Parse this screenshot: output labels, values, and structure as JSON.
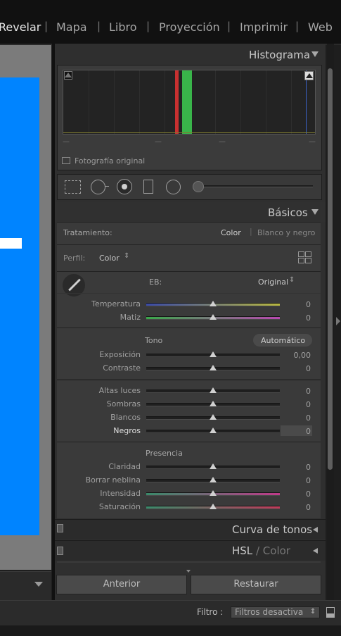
{
  "modules": [
    "Revelar",
    "Mapa",
    "Libro",
    "Proyección",
    "Imprimir",
    "Web"
  ],
  "active_module": "Revelar",
  "histogram": {
    "title": "Histograma",
    "orig_photo_label": "Fotografía original",
    "readouts": [
      "—",
      "—",
      "—",
      "—"
    ]
  },
  "basic": {
    "title": "Básicos",
    "treatment_label": "Tratamiento:",
    "treatment_color": "Color",
    "treatment_bw": "Blanco y negro",
    "profile_label": "Perfil:",
    "profile_value": "Color",
    "wb_label": "EB:",
    "wb_value": "Original",
    "temp_label": "Temperatura",
    "temp_value": "0",
    "tint_label": "Matiz",
    "tint_value": "0",
    "tone_label": "Tono",
    "auto_label": "Automático",
    "exposure_label": "Exposición",
    "exposure_value": "0,00",
    "contrast_label": "Contraste",
    "contrast_value": "0",
    "highlights_label": "Altas luces",
    "highlights_value": "0",
    "shadows_label": "Sombras",
    "shadows_value": "0",
    "whites_label": "Blancos",
    "whites_value": "0",
    "blacks_label": "Negros",
    "blacks_value": "0",
    "presence_label": "Presencia",
    "clarity_label": "Claridad",
    "clarity_value": "0",
    "dehaze_label": "Borrar neblina",
    "dehaze_value": "0",
    "vibrance_label": "Intensidad",
    "vibrance_value": "0",
    "saturation_label": "Saturación",
    "saturation_value": "0"
  },
  "panels": {
    "tone_curve": "Curva de tonos",
    "hsl": "HSL",
    "hsl_sep": "/",
    "color": "Color"
  },
  "buttons": {
    "previous": "Anterior",
    "reset": "Restaurar"
  },
  "filter": {
    "label": "Filtro :",
    "value": "Filtros desactiva"
  },
  "colors": {
    "photo_blue": "#0084ff",
    "histo_red": "#c83030",
    "histo_green": "#39b54a"
  }
}
